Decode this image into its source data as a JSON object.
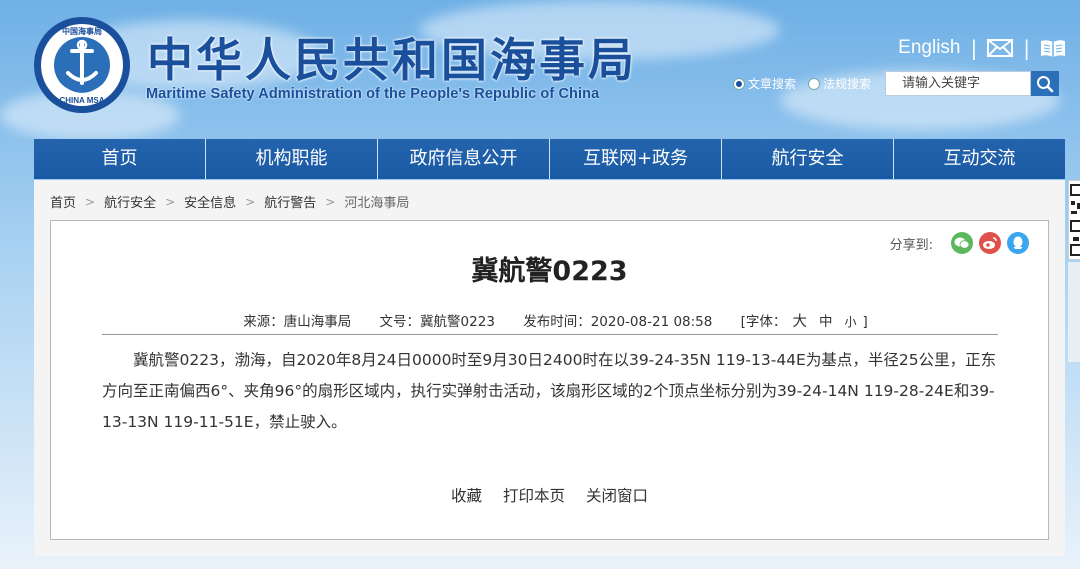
{
  "header": {
    "title_cn": "中华人民共和国海事局",
    "title_en": "Maritime Safety Administration of the People's Republic of China",
    "logo_text": "中国海事局",
    "logo_text_en": "CHINA MSA",
    "english_link": "English",
    "separator": "|"
  },
  "search": {
    "options": [
      {
        "label": "文章搜索",
        "selected": true
      },
      {
        "label": "法规搜索",
        "selected": false
      }
    ],
    "placeholder": "请输入关键字"
  },
  "nav": {
    "items": [
      "首页",
      "机构职能",
      "政府信息公开",
      "互联网+政务",
      "航行安全",
      "互动交流"
    ]
  },
  "breadcrumb": {
    "items": [
      "首页",
      "航行安全",
      "安全信息",
      "航行警告",
      "河北海事局"
    ],
    "separator": ">"
  },
  "article": {
    "share_label": "分享到:",
    "title": "冀航警0223",
    "meta": {
      "source": "来源：唐山海事局",
      "doc_no": "文号：冀航警0223",
      "publish_time": "发布时间：2020-08-21 08:58",
      "font_label": "[字体：",
      "font_large": "大",
      "font_medium": "中",
      "font_small": "小",
      "font_end": "]"
    },
    "body": "冀航警0223，渤海，自2020年8月24日0000时至9月30日2400时在以39-24-35N 119-13-44E为基点，半径25公里，正东方向至正南偏西6°、夹角96°的扇形区域内，执行实弹射击活动，该扇形区域的2个顶点坐标分别为39-24-14N 119-28-24E和39-13-13N 119-11-51E，禁止驶入。",
    "actions": [
      "收藏",
      "打印本页",
      "关闭窗口"
    ]
  },
  "colors": {
    "brand_blue": "#1a4f9c",
    "nav_blue": "#1a5aa4",
    "wechat": "#5cb85c",
    "weibo": "#e0504b",
    "qq": "#3aa6ef"
  }
}
